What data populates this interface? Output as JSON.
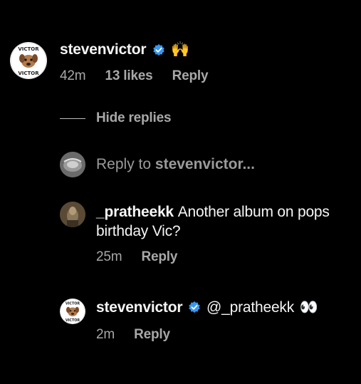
{
  "main_comment": {
    "username": "stevenvictor",
    "emoji": "🙌",
    "time": "42m",
    "likes": "13 likes",
    "reply_label": "Reply",
    "avatar_text_top": "VICTOR",
    "avatar_text_bottom": "VICTOR"
  },
  "replies_toggle": {
    "label": "Hide replies"
  },
  "reply_composer": {
    "prefix": "Reply to",
    "target": "stevenvictor..."
  },
  "reply_1": {
    "username": "_pratheekk",
    "text_line1": "Another album on pops",
    "text_line2": "birthday Vic?",
    "time": "25m",
    "reply_label": "Reply"
  },
  "reply_2": {
    "username": "stevenvictor",
    "mention": "@_pratheekk",
    "emoji": "👀",
    "time": "2m",
    "reply_label": "Reply",
    "avatar_text_top": "VICTOR",
    "avatar_text_bottom": "VICTOR"
  },
  "colors": {
    "background": "#000000",
    "primary_text": "#f5f5f5",
    "secondary_text": "#a8a8a8",
    "verified_blue": "#3897f0"
  }
}
